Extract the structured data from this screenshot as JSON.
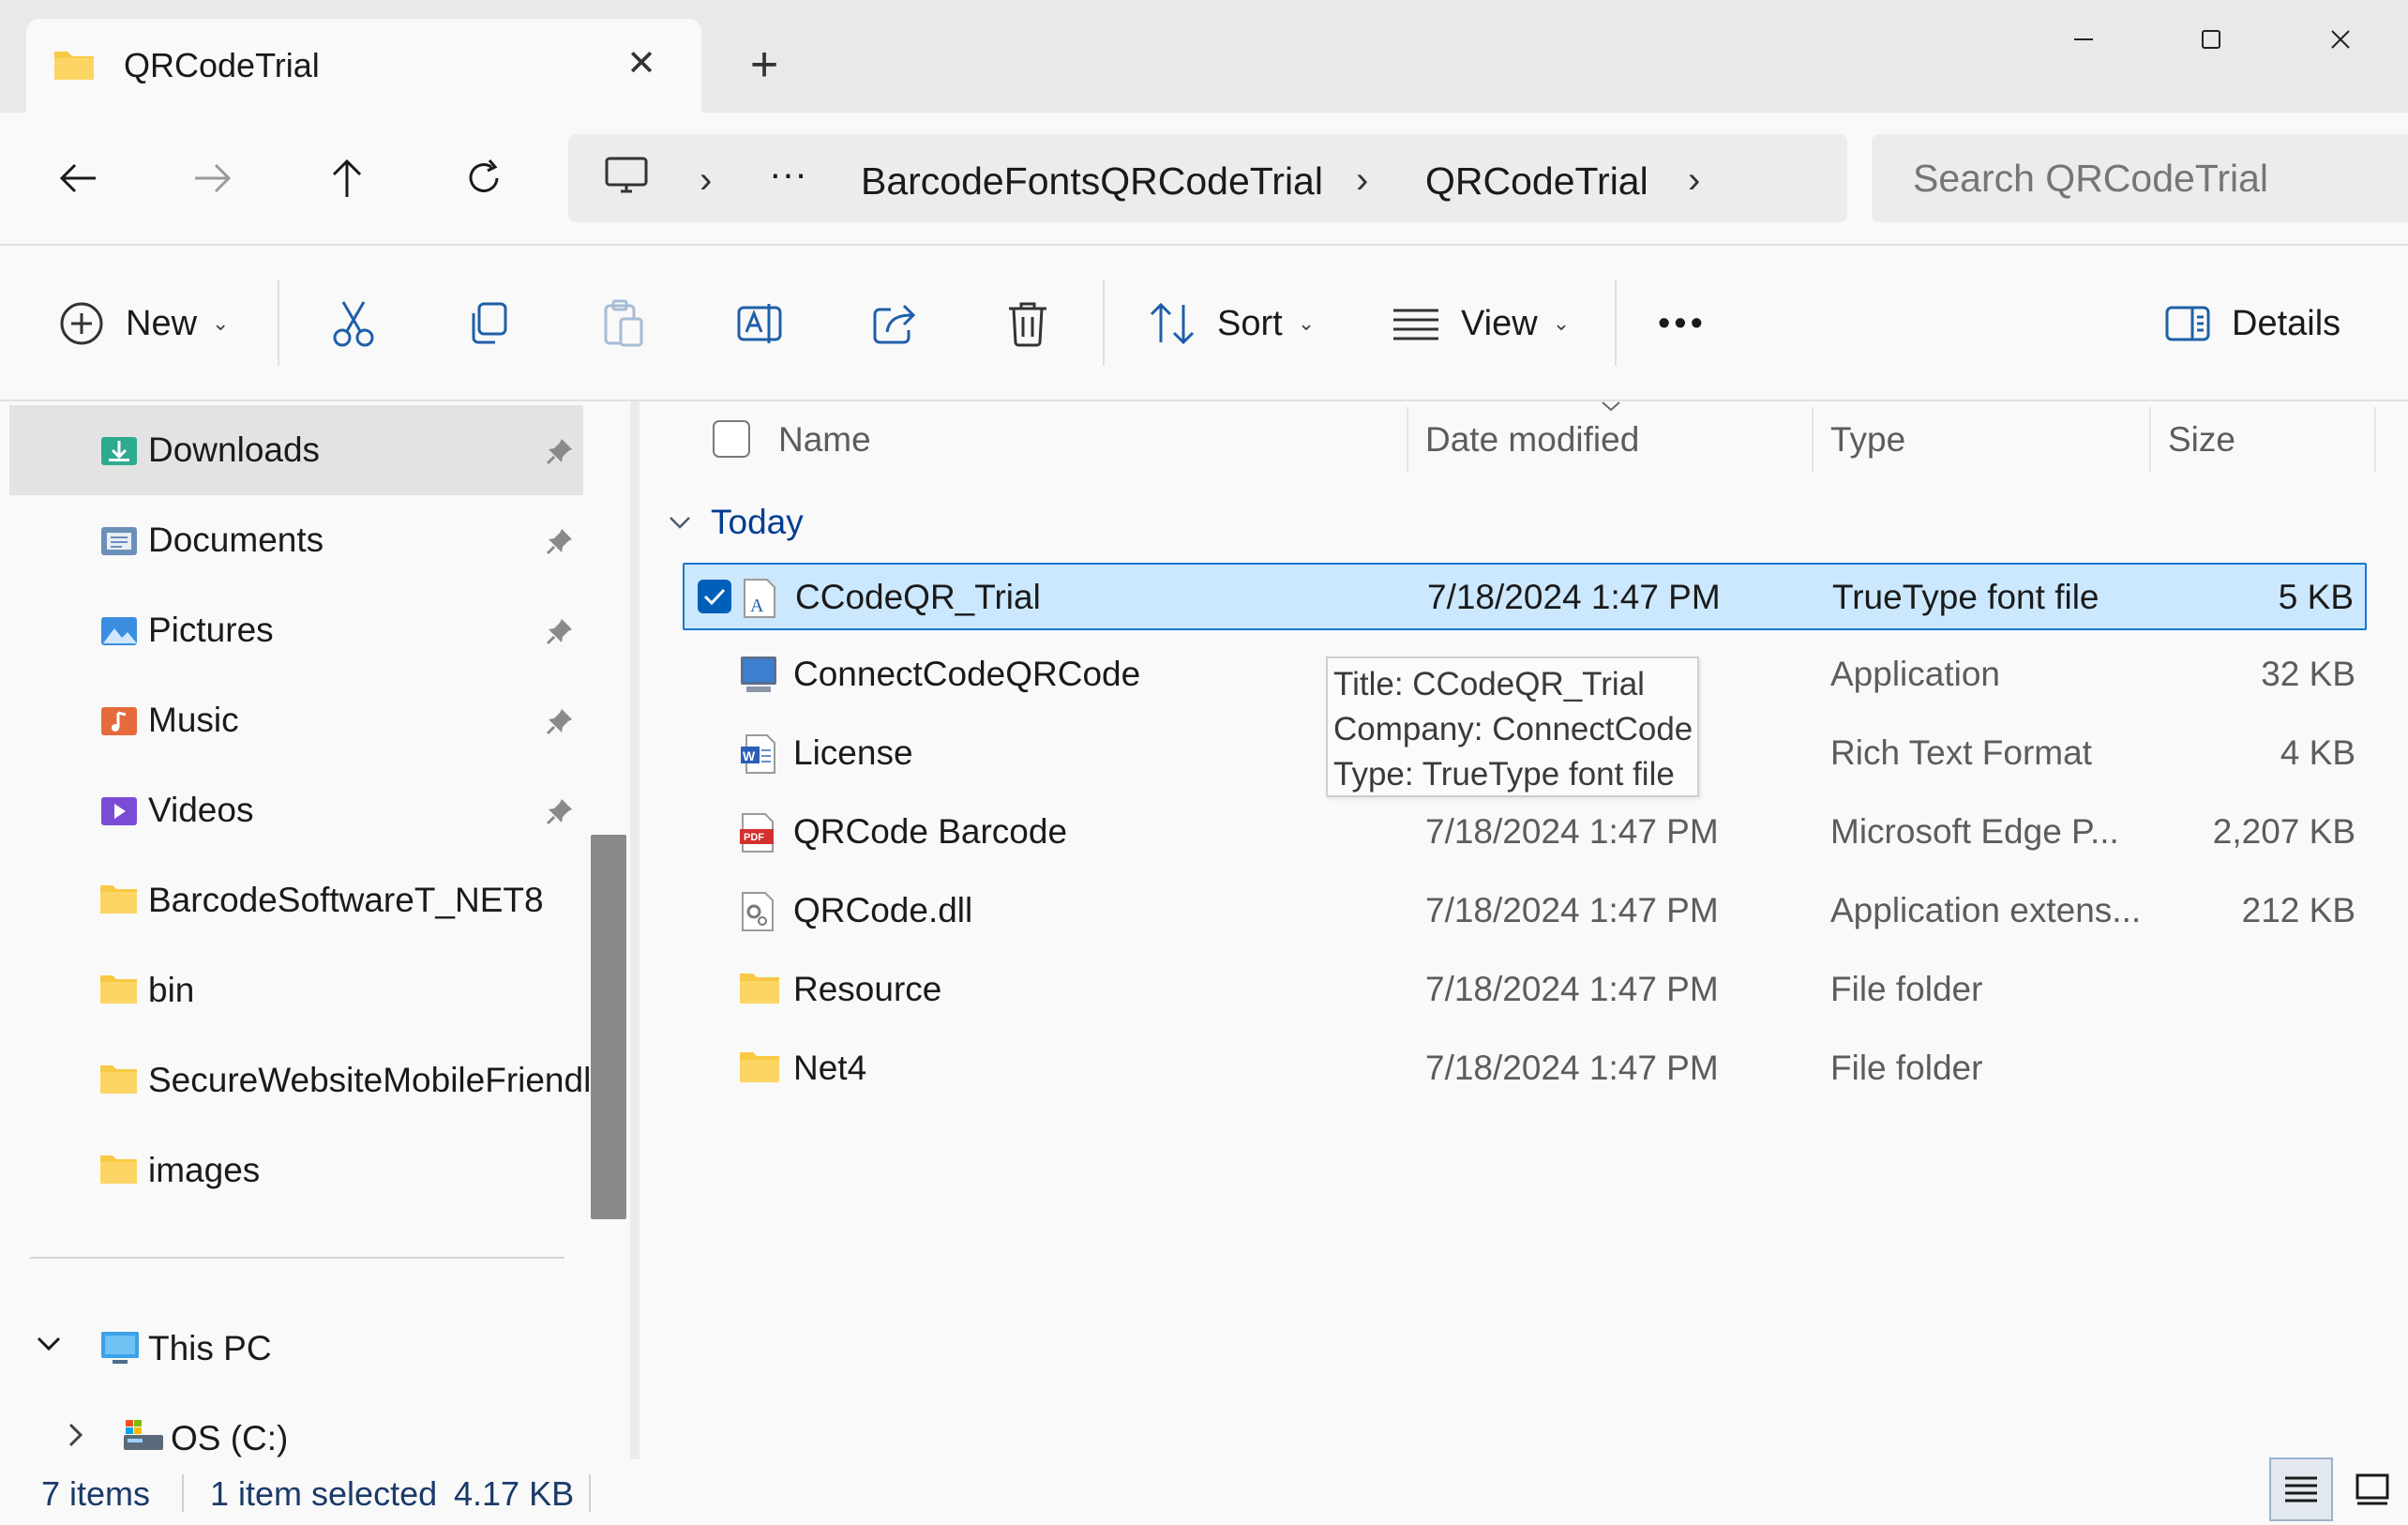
{
  "window": {
    "tab_title": "QRCodeTrial",
    "tab_close_glyph": "✕",
    "new_tab_glyph": "+"
  },
  "address_bar": {
    "more_glyph": "···",
    "crumbs": [
      "BarcodeFontsQRCodeTrial",
      "QRCodeTrial"
    ],
    "chevron_glyph": "›",
    "search_placeholder": "Search QRCodeTrial"
  },
  "toolbar": {
    "new_label": "New",
    "sort_label": "Sort",
    "view_label": "View",
    "more_glyph": "•••",
    "details_label": "Details",
    "caret_glyph": "⌄"
  },
  "nav_pane": {
    "quick_access": [
      {
        "label": "Downloads",
        "icon": "downloads-icon",
        "pinned": true,
        "selected": true
      },
      {
        "label": "Documents",
        "icon": "documents-icon",
        "pinned": true
      },
      {
        "label": "Pictures",
        "icon": "pictures-icon",
        "pinned": true
      },
      {
        "label": "Music",
        "icon": "music-icon",
        "pinned": true
      },
      {
        "label": "Videos",
        "icon": "videos-icon",
        "pinned": true
      },
      {
        "label": "BarcodeSoftwareT_NET8",
        "icon": "folder-icon"
      },
      {
        "label": "bin",
        "icon": "folder-icon"
      },
      {
        "label": "SecureWebsiteMobileFriendly",
        "icon": "folder-icon"
      },
      {
        "label": "images",
        "icon": "folder-icon"
      }
    ],
    "this_pc": {
      "label": "This PC",
      "expanded": true
    },
    "os_drive": {
      "label": "OS (C:)",
      "expanded": false
    }
  },
  "columns": {
    "name": "Name",
    "date_modified": "Date modified",
    "type": "Type",
    "size": "Size",
    "sorted_column": "date_modified"
  },
  "group": {
    "label": "Today"
  },
  "files": [
    {
      "name": "CCodeQR_Trial",
      "date": "7/18/2024 1:47 PM",
      "type": "TrueType font file",
      "size": "5 KB",
      "icon": "font-file-icon",
      "selected": true
    },
    {
      "name": "ConnectCodeQRCode",
      "date": "",
      "type": "Application",
      "size": "32 KB",
      "icon": "application-icon"
    },
    {
      "name": "License",
      "date": "",
      "type": "Rich Text Format",
      "size": "4 KB",
      "icon": "rtf-document-icon"
    },
    {
      "name": "QRCode Barcode",
      "date": "7/18/2024 1:47 PM",
      "type": "Microsoft Edge P...",
      "size": "2,207 KB",
      "icon": "pdf-icon"
    },
    {
      "name": "QRCode.dll",
      "date": "7/18/2024 1:47 PM",
      "type": "Application extens...",
      "size": "212 KB",
      "icon": "dll-icon"
    },
    {
      "name": "Resource",
      "date": "7/18/2024 1:47 PM",
      "type": "File folder",
      "size": "",
      "icon": "folder-icon"
    },
    {
      "name": "Net4",
      "date": "7/18/2024 1:47 PM",
      "type": "File folder",
      "size": "",
      "icon": "folder-icon"
    }
  ],
  "tooltip": {
    "title": "Title: CCodeQR_Trial",
    "company": "Company: ConnectCode",
    "type": "Type: TrueType font file"
  },
  "status_bar": {
    "item_count": "7 items",
    "selection": "1 item selected",
    "selection_size": "4.17 KB"
  },
  "colors": {
    "accent": "#005fb8",
    "selection_bg": "#cce8ff",
    "selection_border": "#1976d2",
    "group_header": "#003e92",
    "folder_yellow": "#f8c945"
  }
}
